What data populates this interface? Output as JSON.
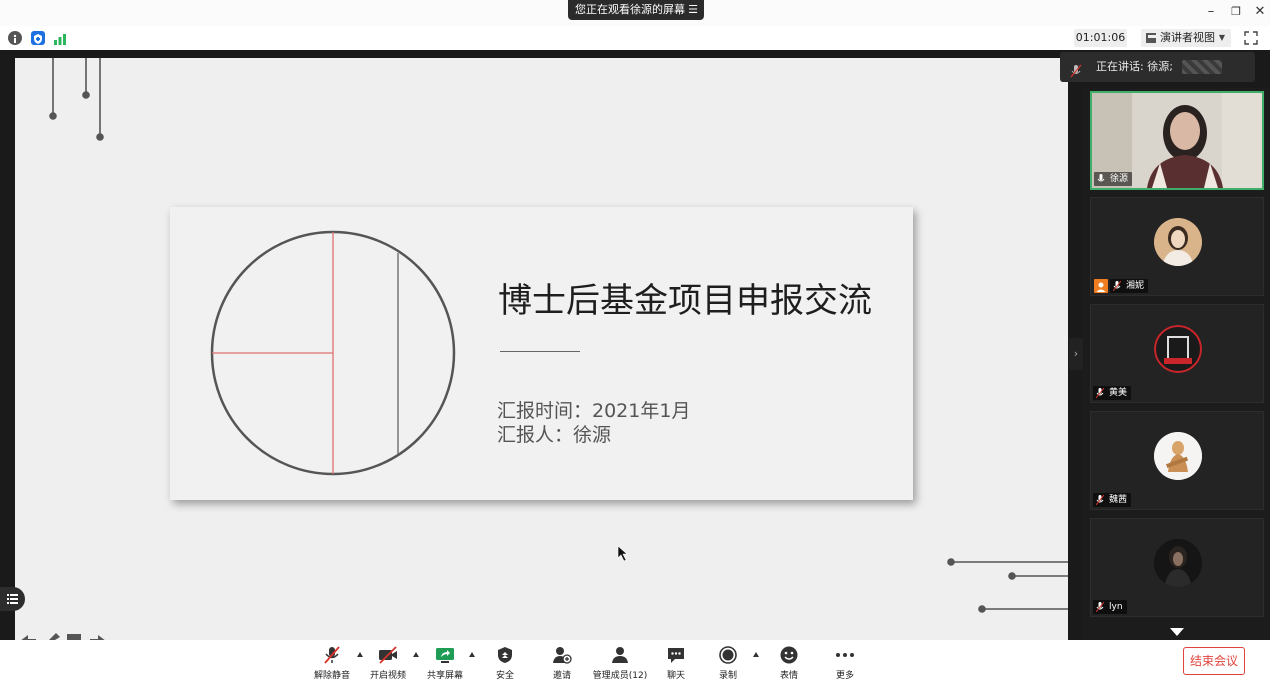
{
  "titlebar": {
    "viewing_label": "您正在观看徐源的屏幕"
  },
  "toolbar": {
    "timer": "01:01:06",
    "view_mode": "演讲者视图"
  },
  "slide": {
    "title": "博士后基金项目申报交流",
    "report_time": "汇报时间：2021年1月",
    "reporter": "汇报人：徐源"
  },
  "speaker": {
    "label": "正在讲话: 徐源;"
  },
  "participants": [
    {
      "name": "徐源",
      "active": true
    },
    {
      "name": "湘妮",
      "active": false
    },
    {
      "name": "黄美",
      "active": false
    },
    {
      "name": "魏茜",
      "active": false
    },
    {
      "name": "lyn",
      "active": false
    }
  ],
  "bottombar": {
    "unmute": "解除静音",
    "start_video": "开启视频",
    "share_screen": "共享屏幕",
    "security": "安全",
    "invite": "邀请",
    "manage_members": "管理成员(12)",
    "chat": "聊天",
    "record": "录制",
    "reactions": "表情",
    "more": "更多",
    "end_meeting": "结束会议"
  },
  "colors": {
    "active_border": "#3fae6a",
    "end_red": "#e0443e",
    "share_green": "#1f9d55",
    "muted_red": "#d9342b"
  }
}
